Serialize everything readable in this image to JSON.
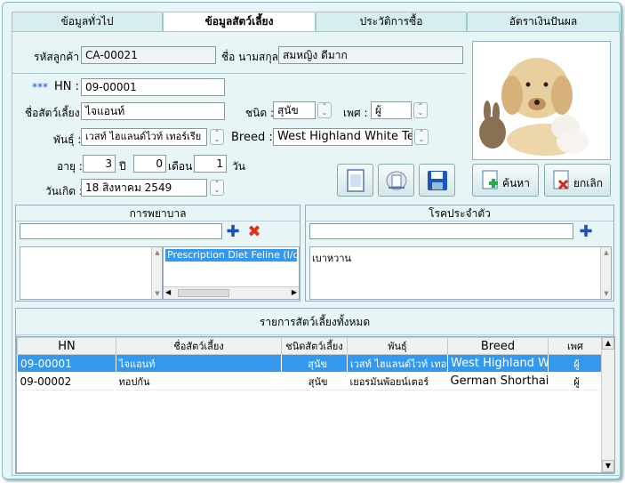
{
  "tabs": [
    "ข้อมูลทั่วไป",
    "ข้อมูลสัตว์เลี้ยง",
    "ประวัติการซื้อ",
    "อัตราเงินปันผล"
  ],
  "owner": {
    "code_label": "รหัสลูกค้า :",
    "code": "CA-00021",
    "name_label": "ชื่อ นามสกุล :",
    "name": "สมหญิง ดีมาก"
  },
  "pet": {
    "hn_prefix": "***",
    "hn_label": "HN :",
    "hn": "09-00001",
    "name_label": "ชื่อสัตว์เลี้ยง :",
    "name": "ไจแอนท์",
    "type_label": "ชนิด :",
    "type": "สุนัข",
    "sex_label": "เพศ :",
    "sex": "ผู้",
    "breed_th_label": "พันธุ์ :",
    "breed_th": "เวสท์ ไฮแลนด์ไวท์ เทอร์เรีย",
    "breed_en_label": "Breed :",
    "breed_en": "West Highland White Terr",
    "age_label": "อายุ :",
    "years": "3",
    "years_unit": "ปี",
    "months": "0",
    "months_unit": "เดือน",
    "days": "1",
    "days_unit": "วัน",
    "dob_label": "วันเกิด :",
    "dob": "18  สิงหาคม    2549"
  },
  "buttons": {
    "search": "ค้นหา",
    "cancel": "ยกเลิก"
  },
  "diet": {
    "title": "การพยาบาล",
    "selected": "Prescription Diet Feline (I/d)"
  },
  "disease": {
    "title": "โรคประจำตัว",
    "items": [
      "เบาหวาน"
    ]
  },
  "table": {
    "title": "รายการสัตว์เลี้ยงทั้งหมด",
    "headers": [
      "HN",
      "ชื่อสัตว์เลี้ยง",
      "ชนิดสัตว์เลี้ยง",
      "พันธุ์",
      "Breed",
      "เพศ"
    ],
    "rows": [
      [
        "09-00001",
        "ไจแอนท์",
        "สุนัข",
        "เวสท์ ไฮแลนด์ไวท์ เทอร์เรีย",
        "West Highland White Terrier",
        "ผู้"
      ],
      [
        "09-00002",
        "ทอปกัน",
        "สุนัข",
        "เยอรมันพ้อยน์เตอร์",
        "German Shorthaired Pointer",
        "ผู้"
      ]
    ]
  },
  "colors": {
    "selection": "#3399ee",
    "panel": "#e8f5f6"
  }
}
